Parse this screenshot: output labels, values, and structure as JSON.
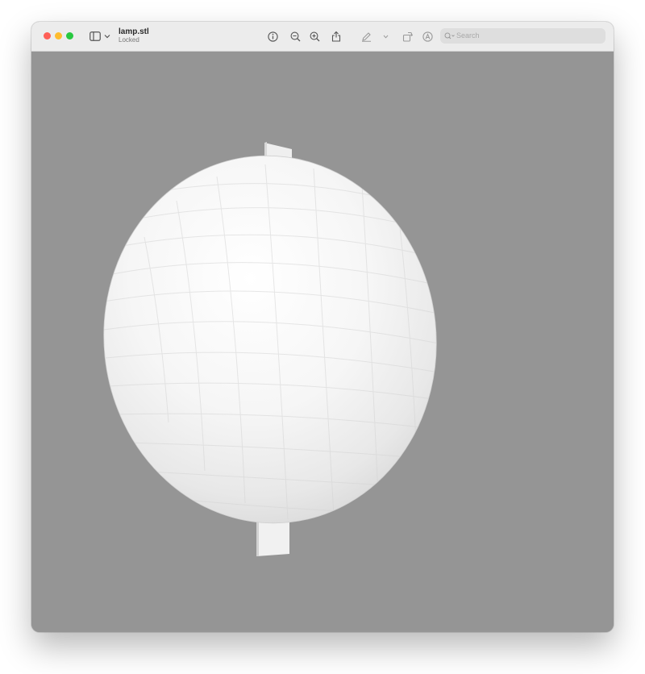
{
  "window": {
    "file_name": "lamp.stl",
    "status": "Locked"
  },
  "toolbar": {
    "icons": [
      "sidebar-icon",
      "chevron-down-icon",
      "info-icon",
      "zoom-out-icon",
      "zoom-in-icon",
      "share-icon",
      "markup-pen-icon",
      "chevron-down-icon",
      "rotate-icon",
      "annotate-icon",
      "search-icon"
    ]
  },
  "search": {
    "placeholder": "Search"
  },
  "viewport": {
    "background": "#959595",
    "model": "lamp 3D mesh"
  },
  "colors": {
    "close": "#fe5f57",
    "minimize": "#febc2e",
    "zoom": "#28c840"
  }
}
